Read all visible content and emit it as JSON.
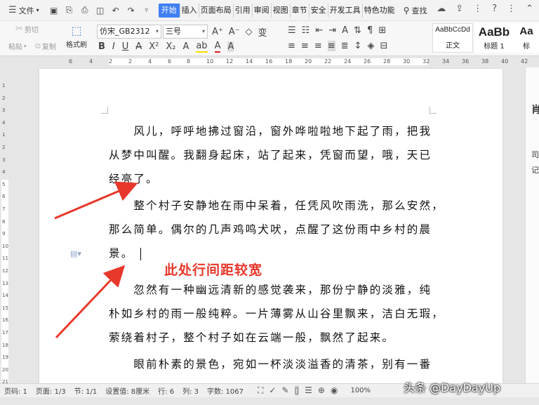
{
  "menubar": {
    "file_label": "文件",
    "tabs": [
      "开始",
      "插入",
      "页面布局",
      "引用",
      "审阅",
      "视图",
      "章节",
      "安全",
      "开发工具",
      "特色功能"
    ],
    "active_tab": "开始",
    "search_label": "查找"
  },
  "ribbon": {
    "cut_label": "剪切",
    "copy_label": "复制",
    "paste_label": "粘贴",
    "format_painter_label": "格式刷",
    "font_name": "仿宋_GB2312",
    "font_size": "三号",
    "styles": [
      {
        "sample": "AaBbCcDd",
        "label": "正文"
      },
      {
        "sample": "AaBb",
        "label": "标题 1"
      },
      {
        "sample": "Aa",
        "label": "标"
      }
    ]
  },
  "ruler": {
    "h_numbers": [
      "6",
      "4",
      "2",
      "2",
      "4",
      "6",
      "8",
      "10",
      "12",
      "14",
      "16",
      "18",
      "20",
      "22",
      "24",
      "26",
      "28",
      "30",
      "32",
      "34",
      "36",
      "38",
      "40",
      "42"
    ],
    "v_numbers": [
      "1",
      "2",
      "3",
      "4",
      "1",
      "2",
      "3",
      "4",
      "5",
      "6",
      "7",
      "8",
      "9",
      "10",
      "11",
      "12",
      "13",
      "14",
      "15",
      "16",
      "17",
      "18",
      "19",
      "20",
      "21"
    ]
  },
  "document": {
    "paragraphs": [
      {
        "lines": [
          "　　风儿，呼呼地拂过窗沿，窗外哗啦啦地下起了雨，把我",
          "从梦中叫醒。我翻身起床，站了起来，凭窗而望，哦，天已",
          "经亮了。"
        ]
      },
      {
        "lines": [
          "　　整个村子安静地在雨中呆着，任凭风吹雨洗，那么安然，",
          "那么简单。偶尔的几声鸡鸣犬吠，点醒了这份雨中乡村的晨",
          "景。"
        ]
      },
      {
        "lines": [
          "　　忽然有一种幽远清新的感觉袭来，那份宁静的淡雅，纯",
          "朴如乡村的雨一般纯粹。一片薄雾从山谷里飘来，洁白无瑕，",
          "萦绕着村子，整个村子如在云端一般，飘然了起来。"
        ]
      },
      {
        "lines": [
          "　　眼前朴素的景色，宛如一杯淡淡溢香的清茶，别有一番"
        ]
      }
    ],
    "annotation": "此处行间距较宽",
    "annotation_color": "#e8382c"
  },
  "right_panel": {
    "chars": [
      "肖",
      "司",
      "记"
    ]
  },
  "status": {
    "page_code": "页码: 1",
    "page": "页面: 1/3",
    "section": "节: 1/1",
    "setting": "设置值: 8厘米",
    "row": "行: 6",
    "col": "列: 3",
    "words": "字数: 1067",
    "zoom": "100%"
  },
  "watermark": "头条 @DayDayUp",
  "colors": {
    "accent": "#3f7ff2",
    "arrow": "#e8382c"
  }
}
